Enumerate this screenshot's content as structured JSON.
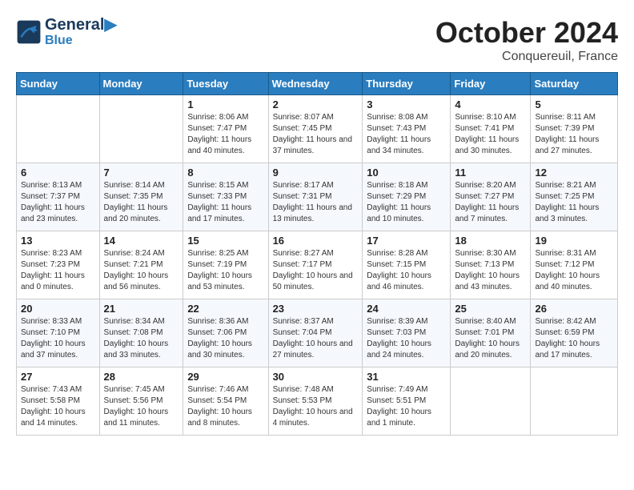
{
  "header": {
    "logo_line1": "General",
    "logo_line2": "Blue",
    "month": "October 2024",
    "location": "Conquereuil, France"
  },
  "weekdays": [
    "Sunday",
    "Monday",
    "Tuesday",
    "Wednesday",
    "Thursday",
    "Friday",
    "Saturday"
  ],
  "weeks": [
    [
      {
        "day": "",
        "info": ""
      },
      {
        "day": "",
        "info": ""
      },
      {
        "day": "1",
        "info": "Sunrise: 8:06 AM\nSunset: 7:47 PM\nDaylight: 11 hours and 40 minutes."
      },
      {
        "day": "2",
        "info": "Sunrise: 8:07 AM\nSunset: 7:45 PM\nDaylight: 11 hours and 37 minutes."
      },
      {
        "day": "3",
        "info": "Sunrise: 8:08 AM\nSunset: 7:43 PM\nDaylight: 11 hours and 34 minutes."
      },
      {
        "day": "4",
        "info": "Sunrise: 8:10 AM\nSunset: 7:41 PM\nDaylight: 11 hours and 30 minutes."
      },
      {
        "day": "5",
        "info": "Sunrise: 8:11 AM\nSunset: 7:39 PM\nDaylight: 11 hours and 27 minutes."
      }
    ],
    [
      {
        "day": "6",
        "info": "Sunrise: 8:13 AM\nSunset: 7:37 PM\nDaylight: 11 hours and 23 minutes."
      },
      {
        "day": "7",
        "info": "Sunrise: 8:14 AM\nSunset: 7:35 PM\nDaylight: 11 hours and 20 minutes."
      },
      {
        "day": "8",
        "info": "Sunrise: 8:15 AM\nSunset: 7:33 PM\nDaylight: 11 hours and 17 minutes."
      },
      {
        "day": "9",
        "info": "Sunrise: 8:17 AM\nSunset: 7:31 PM\nDaylight: 11 hours and 13 minutes."
      },
      {
        "day": "10",
        "info": "Sunrise: 8:18 AM\nSunset: 7:29 PM\nDaylight: 11 hours and 10 minutes."
      },
      {
        "day": "11",
        "info": "Sunrise: 8:20 AM\nSunset: 7:27 PM\nDaylight: 11 hours and 7 minutes."
      },
      {
        "day": "12",
        "info": "Sunrise: 8:21 AM\nSunset: 7:25 PM\nDaylight: 11 hours and 3 minutes."
      }
    ],
    [
      {
        "day": "13",
        "info": "Sunrise: 8:23 AM\nSunset: 7:23 PM\nDaylight: 11 hours and 0 minutes."
      },
      {
        "day": "14",
        "info": "Sunrise: 8:24 AM\nSunset: 7:21 PM\nDaylight: 10 hours and 56 minutes."
      },
      {
        "day": "15",
        "info": "Sunrise: 8:25 AM\nSunset: 7:19 PM\nDaylight: 10 hours and 53 minutes."
      },
      {
        "day": "16",
        "info": "Sunrise: 8:27 AM\nSunset: 7:17 PM\nDaylight: 10 hours and 50 minutes."
      },
      {
        "day": "17",
        "info": "Sunrise: 8:28 AM\nSunset: 7:15 PM\nDaylight: 10 hours and 46 minutes."
      },
      {
        "day": "18",
        "info": "Sunrise: 8:30 AM\nSunset: 7:13 PM\nDaylight: 10 hours and 43 minutes."
      },
      {
        "day": "19",
        "info": "Sunrise: 8:31 AM\nSunset: 7:12 PM\nDaylight: 10 hours and 40 minutes."
      }
    ],
    [
      {
        "day": "20",
        "info": "Sunrise: 8:33 AM\nSunset: 7:10 PM\nDaylight: 10 hours and 37 minutes."
      },
      {
        "day": "21",
        "info": "Sunrise: 8:34 AM\nSunset: 7:08 PM\nDaylight: 10 hours and 33 minutes."
      },
      {
        "day": "22",
        "info": "Sunrise: 8:36 AM\nSunset: 7:06 PM\nDaylight: 10 hours and 30 minutes."
      },
      {
        "day": "23",
        "info": "Sunrise: 8:37 AM\nSunset: 7:04 PM\nDaylight: 10 hours and 27 minutes."
      },
      {
        "day": "24",
        "info": "Sunrise: 8:39 AM\nSunset: 7:03 PM\nDaylight: 10 hours and 24 minutes."
      },
      {
        "day": "25",
        "info": "Sunrise: 8:40 AM\nSunset: 7:01 PM\nDaylight: 10 hours and 20 minutes."
      },
      {
        "day": "26",
        "info": "Sunrise: 8:42 AM\nSunset: 6:59 PM\nDaylight: 10 hours and 17 minutes."
      }
    ],
    [
      {
        "day": "27",
        "info": "Sunrise: 7:43 AM\nSunset: 5:58 PM\nDaylight: 10 hours and 14 minutes."
      },
      {
        "day": "28",
        "info": "Sunrise: 7:45 AM\nSunset: 5:56 PM\nDaylight: 10 hours and 11 minutes."
      },
      {
        "day": "29",
        "info": "Sunrise: 7:46 AM\nSunset: 5:54 PM\nDaylight: 10 hours and 8 minutes."
      },
      {
        "day": "30",
        "info": "Sunrise: 7:48 AM\nSunset: 5:53 PM\nDaylight: 10 hours and 4 minutes."
      },
      {
        "day": "31",
        "info": "Sunrise: 7:49 AM\nSunset: 5:51 PM\nDaylight: 10 hours and 1 minute."
      },
      {
        "day": "",
        "info": ""
      },
      {
        "day": "",
        "info": ""
      }
    ]
  ]
}
